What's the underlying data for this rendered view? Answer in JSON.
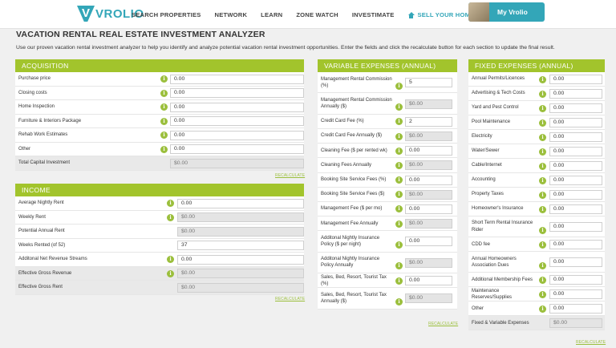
{
  "brand": {
    "logo_text": "VROLIO"
  },
  "nav": {
    "items": [
      "SEARCH PROPERTIES",
      "NETWORK",
      "LEARN",
      "ZONE WATCH",
      "INVESTIMATE"
    ],
    "sell": "SELL YOUR HOME",
    "account": "My Vrolio"
  },
  "page": {
    "title": "VACATION RENTAL REAL ESTATE INVESTMENT ANALYZER",
    "intro": "Use our proven vacation rental investment analyzer to help you identify and analyze potential vacation rental investment opportunities. Enter the fields and click the recalculate button for each section to update the final result."
  },
  "recalculate_label": "RECALCULATE",
  "info_glyph": "i",
  "acquisition": {
    "heading": "ACQUISITION",
    "rows": [
      {
        "label": "Purchase price",
        "value": "0.00"
      },
      {
        "label": "Closing costs",
        "value": "0.00"
      },
      {
        "label": "Home Inspection",
        "value": "0.00"
      },
      {
        "label": "Furniture & Interiors Package",
        "value": "0.00"
      },
      {
        "label": "Rehab Work Estimates",
        "value": "0.00"
      },
      {
        "label": "Other",
        "value": "0.00"
      }
    ],
    "total": {
      "label": "Total Capital Investment",
      "value": "$0.00"
    }
  },
  "income": {
    "heading": "INCOME",
    "rows": [
      {
        "label": "Average Nightly Rent",
        "value": "0.00"
      },
      {
        "label": "Weekly Rent",
        "value": "$0.00"
      },
      {
        "label": "Potential Annual Rent",
        "value": "$0.00"
      },
      {
        "label": "Weeks Rented (of 52)",
        "value": "37"
      },
      {
        "label": "Additonal Net Revenue Streams",
        "value": "0.00"
      },
      {
        "label": "Effective Gross Revenue",
        "value": "$0.00"
      },
      {
        "label": "Effective Gross Rent",
        "value": "$0.00"
      }
    ]
  },
  "variable": {
    "heading": "VARIABLE EXPENSES (ANNUAL)",
    "rows": [
      {
        "label": "Management Rental Commission (%)",
        "value": "5"
      },
      {
        "label": "Management Rental Commission Annually ($)",
        "value": "$0.00"
      },
      {
        "label": "Credit Card Fee (%)",
        "value": "2"
      },
      {
        "label": "Credit Card Fee Annually ($)",
        "value": "$0.00"
      },
      {
        "label": "Cleaning Fee ($ per rented wk)",
        "value": "0.00"
      },
      {
        "label": "Cleaning Fees Annually",
        "value": "$0.00"
      },
      {
        "label": "Booking Site Service Fees (%)",
        "value": "0.00"
      },
      {
        "label": "Booking Site Service Fees ($)",
        "value": "$0.00"
      },
      {
        "label": "Management Fee ($ per mo)",
        "value": "0.00"
      },
      {
        "label": "Management Fee Annually",
        "value": "$0.00"
      },
      {
        "label": "Additonal Nightly Insurance Policy ($ per night)",
        "value": "0.00"
      },
      {
        "label": "Additonal Nightly Insurance Policy Annually",
        "value": "$0.00"
      },
      {
        "label": "Sales, Bed, Resort, Tourist Tax (%)",
        "value": "0.00"
      },
      {
        "label": "Sales, Bed, Resort, Tourist Tax Annually ($)",
        "value": "$0.00"
      }
    ]
  },
  "fixed": {
    "heading": "FIXED EXPENSES (ANNUAL)",
    "rows": [
      {
        "label": "Annual Permits/Licences",
        "value": "0.00"
      },
      {
        "label": "Advertising & Tech Costs",
        "value": "0.00"
      },
      {
        "label": "Yard and Pest Control",
        "value": "0.00"
      },
      {
        "label": "Pool Maintenance",
        "value": "0.00"
      },
      {
        "label": "Electricity",
        "value": "0.00"
      },
      {
        "label": "Water/Sewer",
        "value": "0.00"
      },
      {
        "label": "Cable/Internet",
        "value": "0.00"
      },
      {
        "label": "Accounting",
        "value": "0.00"
      },
      {
        "label": "Property Taxes",
        "value": "0.00"
      },
      {
        "label": "Homeowner's Insurance",
        "value": "0.00"
      },
      {
        "label": "Short Term Rental Insurance Rider",
        "value": "0.00"
      },
      {
        "label": "CDD fee",
        "value": "0.00"
      },
      {
        "label": "Annual Homeowners Association Dues",
        "value": "0.00"
      },
      {
        "label": "Additional Membership Fees",
        "value": "0.00"
      },
      {
        "label": "Maintenance Reserves/Supplies",
        "value": "0.00"
      },
      {
        "label": "Other",
        "value": "0.00"
      }
    ],
    "total": {
      "label": "Fixed & Variable Expenses",
      "value": "$0.00"
    }
  }
}
